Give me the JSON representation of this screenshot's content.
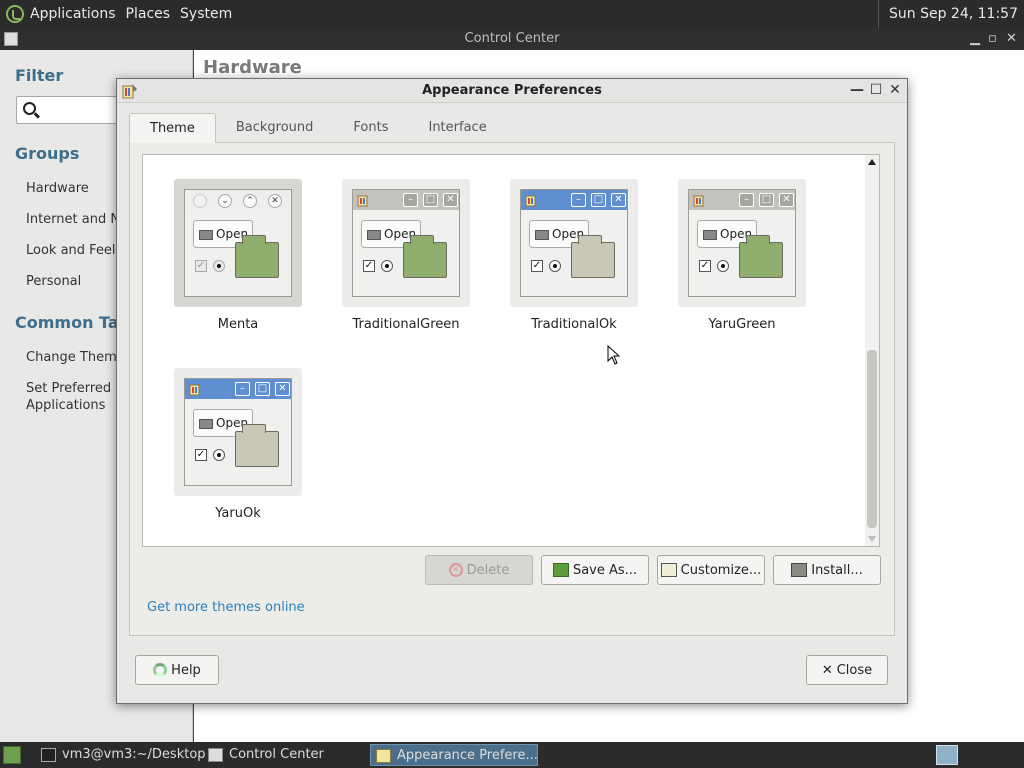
{
  "top_panel": {
    "menus": [
      "Applications",
      "Places",
      "System"
    ],
    "clock": "Sun Sep 24, 11:57"
  },
  "control_center": {
    "title": "Control Center",
    "filter_heading": "Filter",
    "groups_heading": "Groups",
    "groups": [
      "Hardware",
      "Internet and Ne",
      "Look and Feel",
      "Personal"
    ],
    "common_tasks_heading": "Common Task",
    "tasks": [
      "Change Theme",
      "Set Preferred",
      "Applications"
    ],
    "main_heading": "Hardware"
  },
  "dialog": {
    "title": "Appearance Preferences",
    "tabs": [
      "Theme",
      "Background",
      "Fonts",
      "Interface"
    ],
    "active_tab": "Theme",
    "themes": [
      {
        "name": "Menta",
        "selected": true
      },
      {
        "name": "TraditionalGreen",
        "selected": false
      },
      {
        "name": "TraditionalOk",
        "selected": false
      },
      {
        "name": "YaruGreen",
        "selected": false
      },
      {
        "name": "YaruOk",
        "selected": false
      }
    ],
    "preview_button_label": "Open",
    "buttons": {
      "delete": "Delete",
      "save_as": "Save As...",
      "customize": "Customize...",
      "install": "Install..."
    },
    "link": "Get more themes online",
    "help": "Help",
    "close": "Close"
  },
  "taskbar": {
    "tasks": [
      "vm3@vm3:~/Desktop",
      "Control Center",
      "Appearance Prefere..."
    ],
    "active_task": "Appearance Prefere..."
  },
  "colors": {
    "accent_link": "#2f7fb8",
    "heading_blue": "#3d6f8c",
    "yaru_blue": "#5f8fd0",
    "green_folder": "#8fae6e",
    "ok_folder": "#c9c7b5"
  }
}
